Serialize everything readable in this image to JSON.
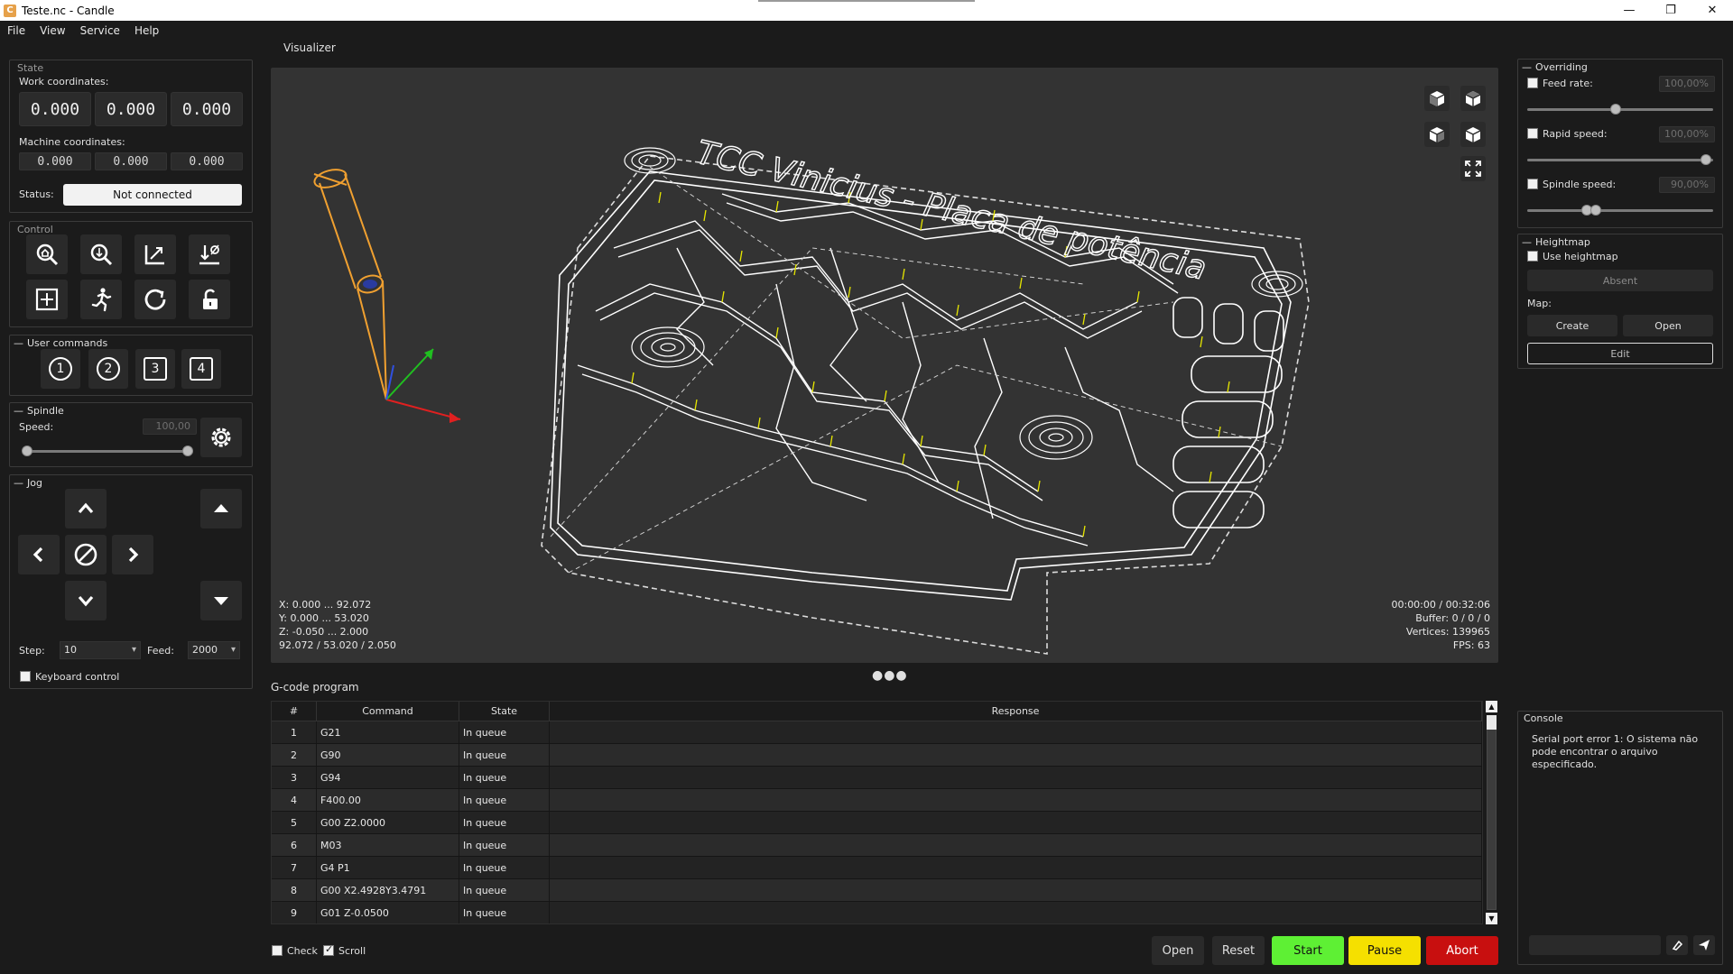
{
  "window": {
    "title": "Teste.nc - Candle",
    "minimize": "—",
    "restore": "❐",
    "close": "✕"
  },
  "menu": [
    "File",
    "View",
    "Service",
    "Help"
  ],
  "state": {
    "title": "State",
    "work_label": "Work coordinates:",
    "work": [
      "0.000",
      "0.000",
      "0.000"
    ],
    "machine_label": "Machine coordinates:",
    "machine": [
      "0.000",
      "0.000",
      "0.000"
    ],
    "status_label": "Status:",
    "status_value": "Not connected"
  },
  "control": {
    "title": "Control"
  },
  "user_commands": {
    "title": "User commands",
    "buttons": [
      "1",
      "2",
      "3",
      "4"
    ]
  },
  "spindle": {
    "title": "Spindle",
    "speed_label": "Speed:",
    "speed_value": "100,00",
    "slider_fraction": 1.0
  },
  "jog": {
    "title": "Jog",
    "step_label": "Step:",
    "step_value": "10",
    "feed_label": "Feed:",
    "feed_value": "2000",
    "keyboard_label": "Keyboard control"
  },
  "visualizer": {
    "label": "Visualizer",
    "info_left": [
      "X: 0.000 ... 92.072",
      "Y: 0.000 ... 53.020",
      "Z: -0.050 ... 2.000",
      "92.072 / 53.020 / 2.050"
    ],
    "info_right": [
      "00:00:00 / 00:32:06",
      "Buffer: 0 / 0 / 0",
      "Vertices: 139965",
      "FPS: 63"
    ],
    "board_text": "TCC Vinicius - Placa de potência"
  },
  "gcode": {
    "label": "G-code program",
    "columns": [
      "#",
      "Command",
      "State",
      "Response"
    ],
    "rows": [
      {
        "n": "1",
        "cmd": "G21",
        "state": "In queue",
        "resp": ""
      },
      {
        "n": "2",
        "cmd": "G90",
        "state": "In queue",
        "resp": ""
      },
      {
        "n": "3",
        "cmd": "G94",
        "state": "In queue",
        "resp": ""
      },
      {
        "n": "4",
        "cmd": "F400.00",
        "state": "In queue",
        "resp": ""
      },
      {
        "n": "5",
        "cmd": "G00 Z2.0000",
        "state": "In queue",
        "resp": ""
      },
      {
        "n": "6",
        "cmd": "M03",
        "state": "In queue",
        "resp": ""
      },
      {
        "n": "7",
        "cmd": "G4 P1",
        "state": "In queue",
        "resp": ""
      },
      {
        "n": "8",
        "cmd": "G00 X2.4928Y3.4791",
        "state": "In queue",
        "resp": ""
      },
      {
        "n": "9",
        "cmd": "G01 Z-0.0500",
        "state": "In queue",
        "resp": ""
      }
    ],
    "check_label": "Check",
    "scroll_label": "Scroll"
  },
  "buttons": {
    "open": "Open",
    "reset": "Reset",
    "start": "Start",
    "pause": "Pause",
    "abort": "Abort"
  },
  "overriding": {
    "title": "Overriding",
    "feed_label": "Feed rate:",
    "feed_value": "100,00%",
    "feed_fraction": 0.48,
    "rapid_label": "Rapid speed:",
    "rapid_value": "100,00%",
    "rapid_fraction": 1.0,
    "spindle_label": "Spindle speed:",
    "spindle_value": "90,00%",
    "spindle_fraction": 0.33
  },
  "heightmap": {
    "title": "Heightmap",
    "use_label": "Use heightmap",
    "absent": "Absent",
    "map_label": "Map:",
    "create": "Create",
    "open": "Open",
    "edit": "Edit"
  },
  "console": {
    "title": "Console",
    "text": "Serial port error 1: O sistema não pode encontrar o arquivo especificado."
  },
  "colors": {
    "start": "#5ef034",
    "pause": "#f5e000",
    "abort": "#c80f0f",
    "visualizer_bg": "#333333",
    "toolpath": "#ffffff",
    "tool": "#f0a030"
  }
}
